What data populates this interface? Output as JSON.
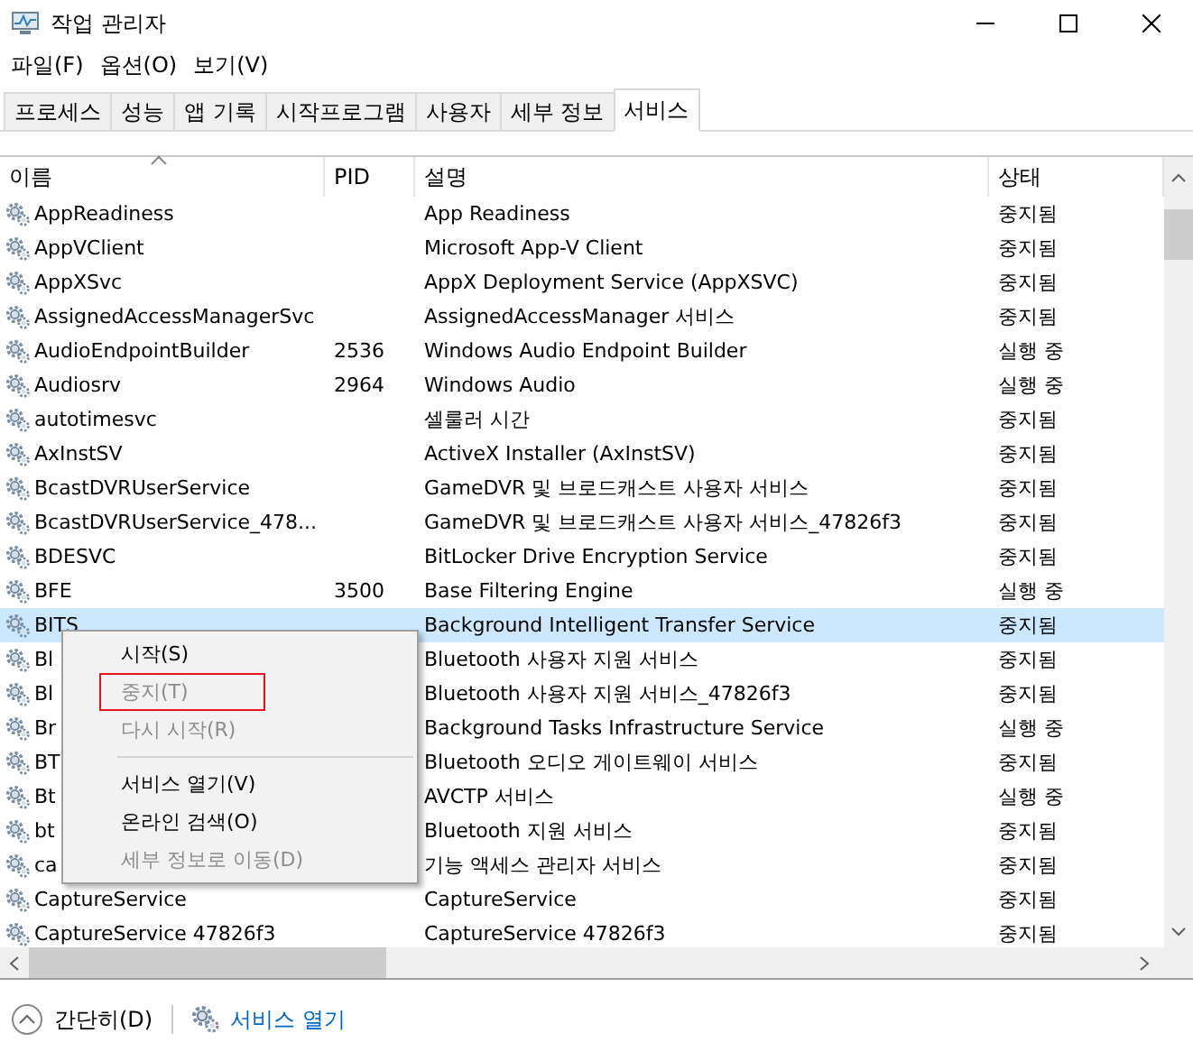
{
  "window": {
    "title": "작업 관리자"
  },
  "menu": [
    "파일(F)",
    "옵션(O)",
    "보기(V)"
  ],
  "tabs": [
    {
      "label": "프로세스",
      "selected": false
    },
    {
      "label": "성능",
      "selected": false
    },
    {
      "label": "앱 기록",
      "selected": false
    },
    {
      "label": "시작프로그램",
      "selected": false
    },
    {
      "label": "사용자",
      "selected": false
    },
    {
      "label": "세부 정보",
      "selected": false
    },
    {
      "label": "서비스",
      "selected": true
    }
  ],
  "table": {
    "columns": [
      {
        "label": "이름",
        "sorted": true
      },
      {
        "label": "PID",
        "sorted": false
      },
      {
        "label": "설명",
        "sorted": false
      },
      {
        "label": "상태",
        "sorted": false
      }
    ],
    "rows": [
      {
        "name": "AppReadiness",
        "pid": "",
        "description": "App Readiness",
        "status": "중지됨",
        "selected": false
      },
      {
        "name": "AppVClient",
        "pid": "",
        "description": "Microsoft App-V Client",
        "status": "중지됨",
        "selected": false
      },
      {
        "name": "AppXSvc",
        "pid": "",
        "description": "AppX Deployment Service (AppXSVC)",
        "status": "중지됨",
        "selected": false
      },
      {
        "name": "AssignedAccessManagerSvc",
        "pid": "",
        "description": "AssignedAccessManager 서비스",
        "status": "중지됨",
        "selected": false
      },
      {
        "name": "AudioEndpointBuilder",
        "pid": "2536",
        "description": "Windows Audio Endpoint Builder",
        "status": "실행 중",
        "selected": false
      },
      {
        "name": "Audiosrv",
        "pid": "2964",
        "description": "Windows Audio",
        "status": "실행 중",
        "selected": false
      },
      {
        "name": "autotimesvc",
        "pid": "",
        "description": "셀룰러 시간",
        "status": "중지됨",
        "selected": false
      },
      {
        "name": "AxInstSV",
        "pid": "",
        "description": "ActiveX Installer (AxInstSV)",
        "status": "중지됨",
        "selected": false
      },
      {
        "name": "BcastDVRUserService",
        "pid": "",
        "description": "GameDVR 및 브로드캐스트 사용자 서비스",
        "status": "중지됨",
        "selected": false
      },
      {
        "name": "BcastDVRUserService_478...",
        "pid": "",
        "description": "GameDVR 및 브로드캐스트 사용자 서비스_47826f3",
        "status": "중지됨",
        "selected": false
      },
      {
        "name": "BDESVC",
        "pid": "",
        "description": "BitLocker Drive Encryption Service",
        "status": "중지됨",
        "selected": false
      },
      {
        "name": "BFE",
        "pid": "3500",
        "description": "Base Filtering Engine",
        "status": "실행 중",
        "selected": false
      },
      {
        "name": "BITS",
        "pid": "",
        "description": "Background Intelligent Transfer Service",
        "status": "중지됨",
        "selected": true
      },
      {
        "name": "Bl",
        "pid": "",
        "description": "Bluetooth 사용자 지원 서비스",
        "status": "중지됨",
        "selected": false
      },
      {
        "name": "Bl",
        "pid": "",
        "description": "Bluetooth 사용자 지원 서비스_47826f3",
        "status": "중지됨",
        "selected": false
      },
      {
        "name": "Br",
        "pid": "",
        "description": "Background Tasks Infrastructure Service",
        "status": "실행 중",
        "selected": false
      },
      {
        "name": "BT",
        "pid": "",
        "description": "Bluetooth 오디오 게이트웨이 서비스",
        "status": "중지됨",
        "selected": false
      },
      {
        "name": "Bt",
        "pid": "",
        "description": "AVCTP 서비스",
        "status": "실행 중",
        "selected": false
      },
      {
        "name": "bt",
        "pid": "",
        "description": "Bluetooth 지원 서비스",
        "status": "중지됨",
        "selected": false
      },
      {
        "name": "ca",
        "pid": "",
        "description": "기능 액세스 관리자 서비스",
        "status": "중지됨",
        "selected": false
      },
      {
        "name": "CaptureService",
        "pid": "",
        "description": "CaptureService",
        "status": "중지됨",
        "selected": false
      },
      {
        "name": "CaptureService 47826f3",
        "pid": "",
        "description": "CaptureService 47826f3",
        "status": "중지됨",
        "selected": false
      }
    ]
  },
  "context_menu": {
    "items": [
      {
        "kind": "item",
        "label": "시작(S)",
        "disabled": false,
        "focused": false
      },
      {
        "kind": "item",
        "label": "중지(T)",
        "disabled": true,
        "focused": true
      },
      {
        "kind": "item",
        "label": "다시 시작(R)",
        "disabled": true,
        "focused": false
      },
      {
        "kind": "separator"
      },
      {
        "kind": "item",
        "label": "서비스 열기(V)",
        "disabled": false,
        "focused": false
      },
      {
        "kind": "item",
        "label": "온라인 검색(O)",
        "disabled": false,
        "focused": false
      },
      {
        "kind": "item",
        "label": "세부 정보로 이동(D)",
        "disabled": true,
        "focused": false
      }
    ]
  },
  "footer": {
    "collapse": "간단히(D)",
    "link": "서비스 열기"
  }
}
